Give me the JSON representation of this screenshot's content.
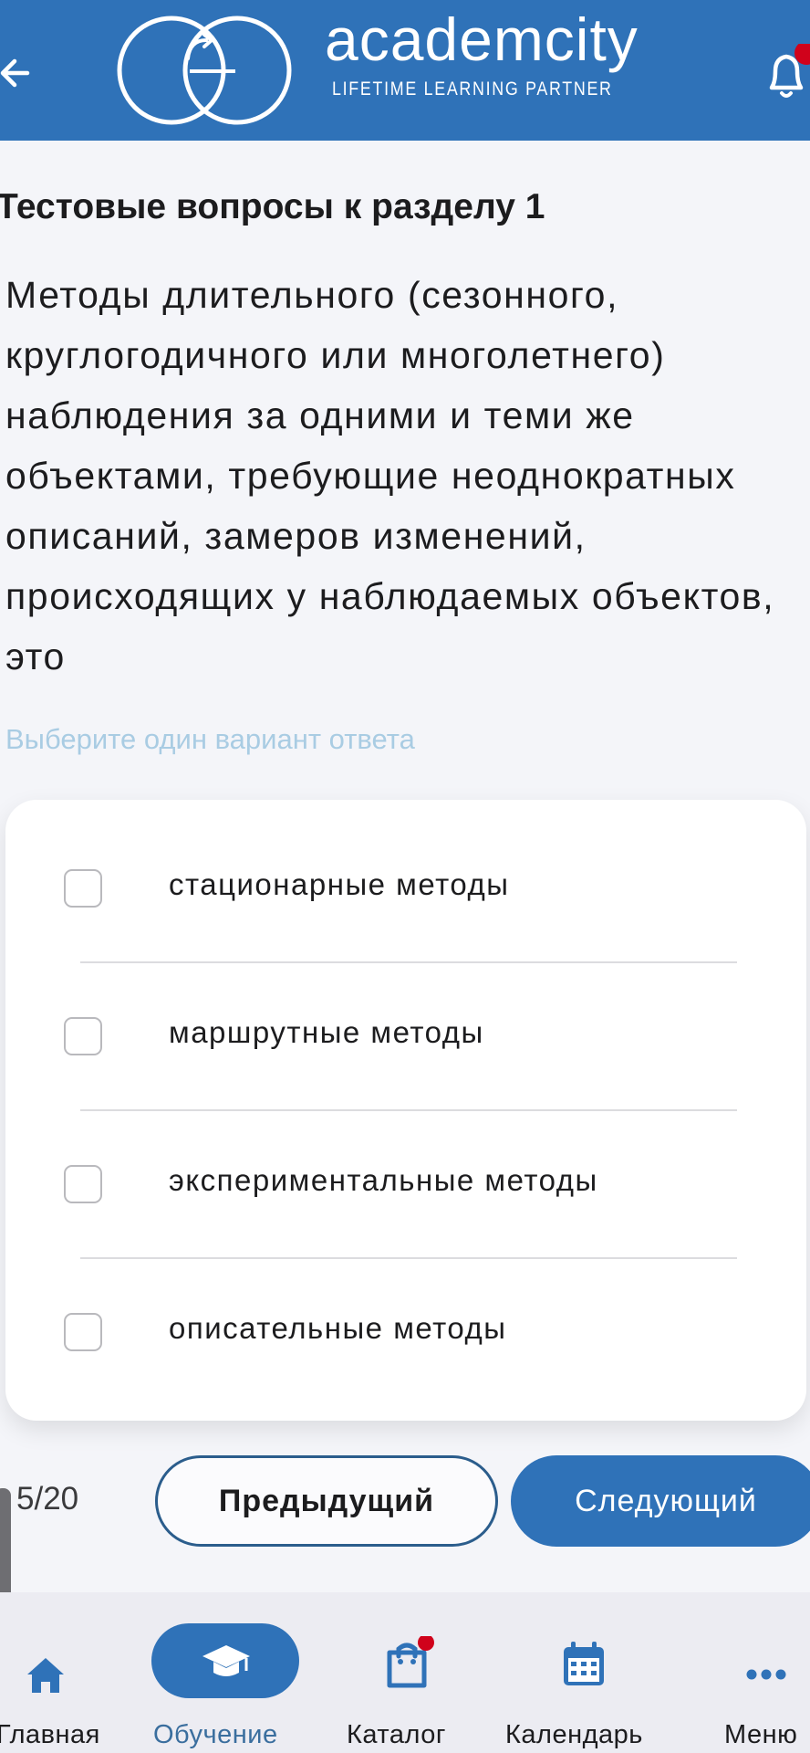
{
  "header": {
    "back_icon": "arrow-left-icon",
    "brand_name": "academcity",
    "brand_tagline": "LIFETIME LEARNING PARTNER",
    "bell_icon": "bell-icon",
    "colors": {
      "header_bg": "#2f72b8",
      "badge": "#d0021b"
    }
  },
  "quiz": {
    "section_title": "Тестовые вопросы к разделу 1",
    "question": "Методы длительного (сезонного, круглогодичного или многолетнего) наблюдения за одними и теми же объектами, требующие неоднократных описаний, замеров изменений, происходящих у наблюдаемых объектов, это",
    "hint": "Выберите один вариант ответа",
    "options": [
      {
        "label": "стационарные методы",
        "checked": false
      },
      {
        "label": "маршрутные методы",
        "checked": false
      },
      {
        "label": "экспериментальные методы",
        "checked": false
      },
      {
        "label": "описательные методы",
        "checked": false
      }
    ]
  },
  "pager": {
    "counter": "5/20",
    "prev_label": "Предыдущий",
    "next_label": "Следующий"
  },
  "tabbar": {
    "items": [
      {
        "label": "Главная",
        "icon": "home-icon",
        "active": false
      },
      {
        "label": "Обучение",
        "icon": "graduation-cap-icon",
        "active": true
      },
      {
        "label": "Каталог",
        "icon": "shopping-bag-icon",
        "active": false
      },
      {
        "label": "Календарь",
        "icon": "calendar-icon",
        "active": false
      },
      {
        "label": "Меню",
        "icon": "more-dots-icon",
        "active": false
      }
    ]
  }
}
